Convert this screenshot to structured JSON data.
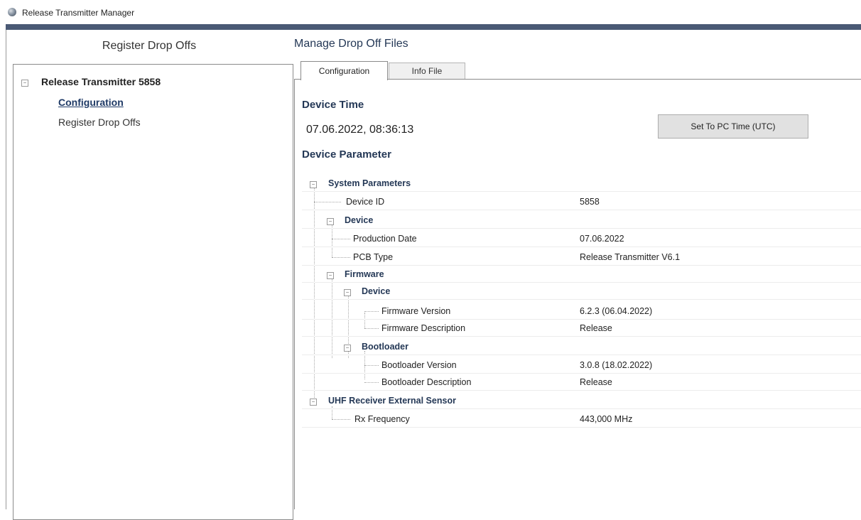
{
  "window": {
    "title": "Release Transmitter Manager"
  },
  "left": {
    "header": "Register Drop Offs",
    "root_label": "Release Transmitter 5858",
    "items": [
      {
        "label": "Configuration",
        "selected": true
      },
      {
        "label": "Register Drop Offs",
        "selected": false
      }
    ]
  },
  "right": {
    "header": "Manage Drop Off Files",
    "tabs": [
      {
        "label": "Configuration",
        "active": true
      },
      {
        "label": "Info File",
        "active": false
      }
    ],
    "device_time": {
      "title": "Device Time",
      "value": "07.06.2022, 08:36:13",
      "button": "Set To PC Time (UTC)"
    },
    "device_parameter": {
      "title": "Device Parameter",
      "rows": [
        {
          "label": "System Parameters",
          "value": "",
          "category": true
        },
        {
          "label": "Device ID",
          "value": "5858"
        },
        {
          "label": "Device",
          "value": "",
          "category": true
        },
        {
          "label": "Production Date",
          "value": "07.06.2022"
        },
        {
          "label": "PCB Type",
          "value": "Release Transmitter V6.1"
        },
        {
          "label": "Firmware",
          "value": "",
          "category": true
        },
        {
          "label": "Device",
          "value": "",
          "category": true
        },
        {
          "label": "Firmware Version",
          "value": "6.2.3 (06.04.2022)"
        },
        {
          "label": "Firmware Description",
          "value": "Release"
        },
        {
          "label": "Bootloader",
          "value": "",
          "category": true
        },
        {
          "label": "Bootloader Version",
          "value": "3.0.8 (18.02.2022)"
        },
        {
          "label": "Bootloader Description",
          "value": "Release"
        },
        {
          "label": "UHF Receiver External Sensor",
          "value": "",
          "category": true
        },
        {
          "label": "Rx Frequency",
          "value": "443,000 MHz"
        }
      ]
    }
  },
  "colors": {
    "accent_bar": "#4a5a75",
    "heading_blue": "#243856",
    "link_blue": "#1f3a66"
  },
  "icons": {
    "app": "globe-icon",
    "collapse": "minus-box-icon"
  }
}
